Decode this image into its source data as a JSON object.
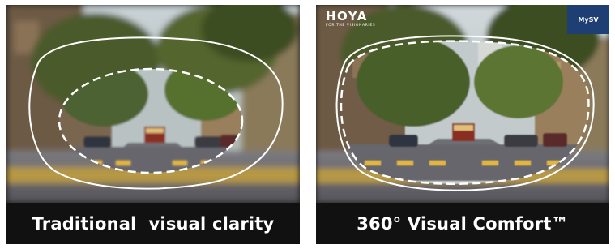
{
  "panels": {
    "left": {
      "caption": "Traditional  visual clarity"
    },
    "right": {
      "caption": "360° Visual Comfort™",
      "logo": {
        "brand": "HOYA",
        "tagline": "FOR THE VISIONARIES"
      },
      "badge": "MySV"
    }
  },
  "colors": {
    "caption_background": "#111111",
    "caption_text": "#ffffff",
    "badge_background": "#1d3f73",
    "lens_outline": "#ffffff"
  }
}
